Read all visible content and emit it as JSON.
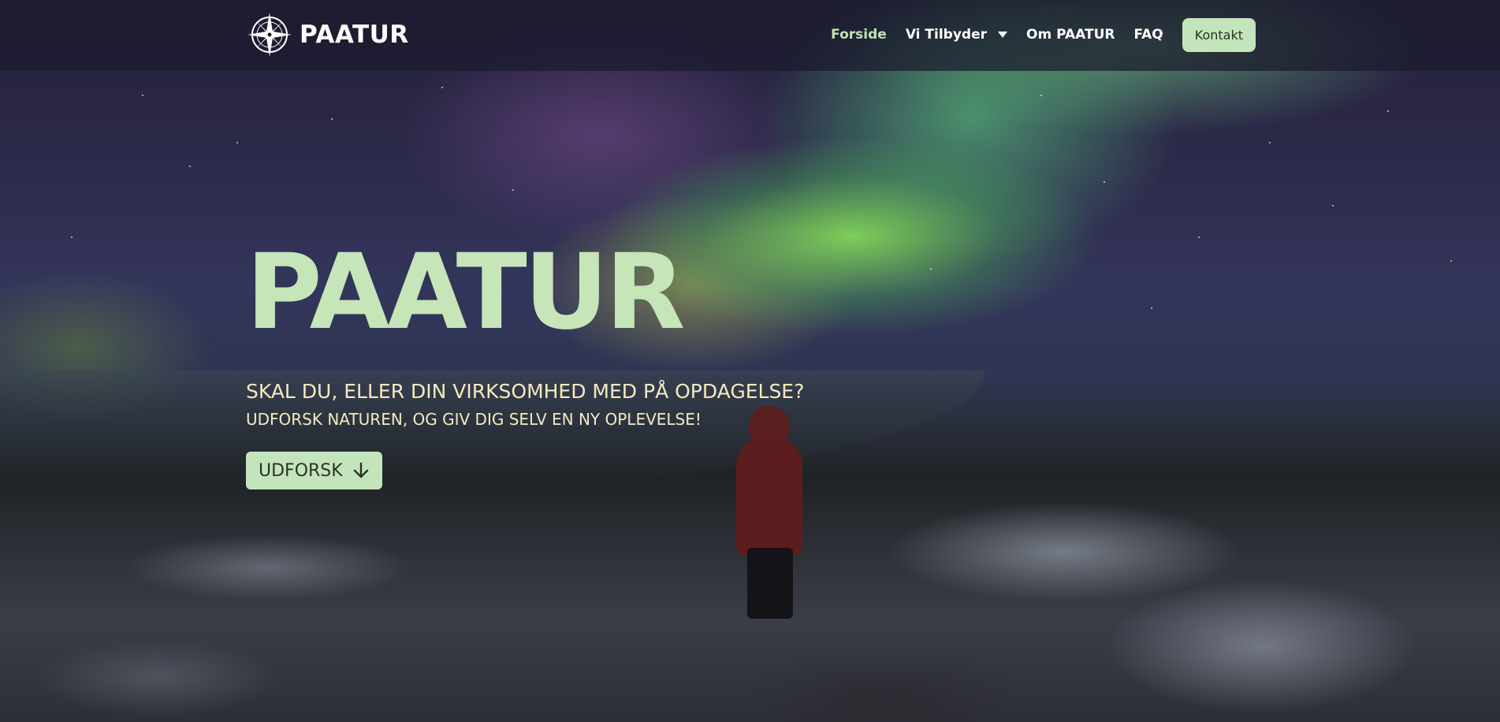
{
  "brand": {
    "name": "PAATUR",
    "logo_icon": "compass-rose-icon"
  },
  "nav": {
    "items": [
      {
        "label": "Forside",
        "active": true
      },
      {
        "label": "Vi Tilbyder",
        "has_dropdown": true
      },
      {
        "label": "Om PAATUR"
      },
      {
        "label": "FAQ"
      }
    ],
    "contact_label": "Kontakt"
  },
  "hero": {
    "title": "PAATUR",
    "tagline": "SKAL DU, ELLER DIN VIRKSOMHED MED PÅ OPDAGELSE?",
    "subtagline": "UDFORSK NATUREN, OG GIV DIG SELV EN NY OPLEVELSE!",
    "cta_label": "UDFORSK",
    "cta_icon": "arrow-down-icon"
  },
  "colors": {
    "accent_green": "#c4e5bb",
    "headline_green": "#c6e5b8",
    "tagline_cream": "#f2eac0",
    "navbar_bg": "#1b1a2c",
    "active_nav": "#bfe3b5"
  }
}
